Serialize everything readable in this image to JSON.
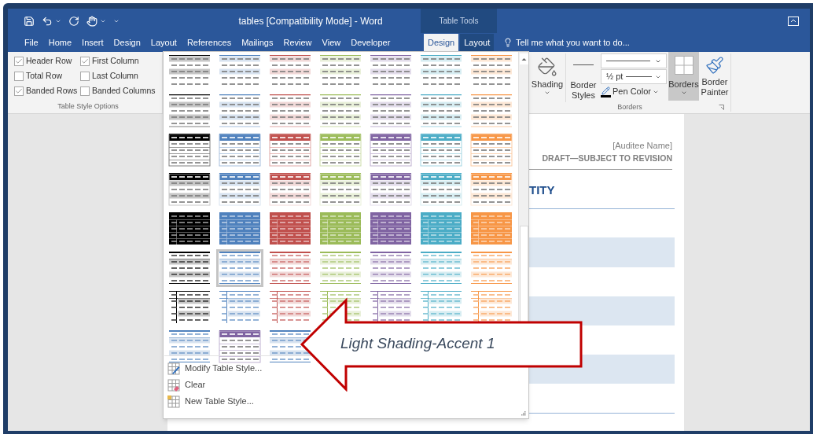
{
  "window": {
    "title": "tables [Compatibility Mode] - Word",
    "contextual_group": "Table Tools"
  },
  "tabs": [
    {
      "label": "File",
      "selected": false,
      "contextual": false
    },
    {
      "label": "Home",
      "selected": false,
      "contextual": false
    },
    {
      "label": "Insert",
      "selected": false,
      "contextual": false
    },
    {
      "label": "Design",
      "selected": false,
      "contextual": false
    },
    {
      "label": "Layout",
      "selected": false,
      "contextual": false
    },
    {
      "label": "References",
      "selected": false,
      "contextual": false
    },
    {
      "label": "Mailings",
      "selected": false,
      "contextual": false
    },
    {
      "label": "Review",
      "selected": false,
      "contextual": false
    },
    {
      "label": "View",
      "selected": false,
      "contextual": false
    },
    {
      "label": "Developer",
      "selected": false,
      "contextual": false
    },
    {
      "label": "Design",
      "selected": true,
      "contextual": true
    },
    {
      "label": "Layout",
      "selected": false,
      "contextual": true
    }
  ],
  "tell_me": {
    "placeholder": "Tell me what you want to do..."
  },
  "table_style_options": {
    "label": "Table Style Options",
    "options": [
      {
        "label": "Header Row",
        "checked": true
      },
      {
        "label": "First Column",
        "checked": true
      },
      {
        "label": "Total Row",
        "checked": false
      },
      {
        "label": "Last Column",
        "checked": false
      },
      {
        "label": "Banded Rows",
        "checked": true
      },
      {
        "label": "Banded Columns",
        "checked": false
      }
    ]
  },
  "borders_group": {
    "label": "Borders",
    "shading": "Shading",
    "border_styles": "Border Styles",
    "line_weight": "½ pt",
    "pen_color": "Pen Color",
    "borders": {
      "label": "Borders",
      "selected": true
    },
    "border_painter": "Border Painter"
  },
  "style_gallery": {
    "styles": [
      {
        "kind": "banded",
        "color": "#000000",
        "selected": false
      },
      {
        "kind": "banded",
        "color": "#4f81bd",
        "selected": false
      },
      {
        "kind": "banded",
        "color": "#c0504d",
        "selected": false
      },
      {
        "kind": "banded",
        "color": "#9bbb59",
        "selected": false
      },
      {
        "kind": "banded",
        "color": "#8064a2",
        "selected": false
      },
      {
        "kind": "banded",
        "color": "#4bacc6",
        "selected": false
      },
      {
        "kind": "banded",
        "color": "#f79646",
        "selected": false
      },
      {
        "kind": "banded-lined",
        "color": "#000000",
        "selected": false
      },
      {
        "kind": "banded-lined",
        "color": "#4f81bd",
        "selected": false
      },
      {
        "kind": "banded-lined",
        "color": "#c0504d",
        "selected": false
      },
      {
        "kind": "banded-lined",
        "color": "#9bbb59",
        "selected": false
      },
      {
        "kind": "banded-lined",
        "color": "#8064a2",
        "selected": false
      },
      {
        "kind": "banded-lined",
        "color": "#4bacc6",
        "selected": false
      },
      {
        "kind": "banded-lined",
        "color": "#f79646",
        "selected": false
      },
      {
        "kind": "grid-header",
        "color": "#000000",
        "selected": false
      },
      {
        "kind": "grid-header",
        "color": "#4f81bd",
        "selected": false
      },
      {
        "kind": "grid-header",
        "color": "#c0504d",
        "selected": false
      },
      {
        "kind": "grid-header",
        "color": "#9bbb59",
        "selected": false
      },
      {
        "kind": "grid-header",
        "color": "#8064a2",
        "selected": false
      },
      {
        "kind": "grid-header",
        "color": "#4bacc6",
        "selected": false
      },
      {
        "kind": "grid-header",
        "color": "#f79646",
        "selected": false
      },
      {
        "kind": "header-banded",
        "color": "#000000",
        "selected": false
      },
      {
        "kind": "header-banded",
        "color": "#4f81bd",
        "selected": false
      },
      {
        "kind": "header-banded",
        "color": "#c0504d",
        "selected": false
      },
      {
        "kind": "header-banded",
        "color": "#9bbb59",
        "selected": false
      },
      {
        "kind": "header-banded",
        "color": "#8064a2",
        "selected": false
      },
      {
        "kind": "header-banded",
        "color": "#4bacc6",
        "selected": false
      },
      {
        "kind": "header-banded",
        "color": "#f79646",
        "selected": false
      },
      {
        "kind": "solid",
        "color": "#000000",
        "selected": false
      },
      {
        "kind": "solid",
        "color": "#4f81bd",
        "selected": false
      },
      {
        "kind": "solid",
        "color": "#c0504d",
        "selected": false
      },
      {
        "kind": "solid",
        "color": "#9bbb59",
        "selected": false
      },
      {
        "kind": "solid",
        "color": "#8064a2",
        "selected": false
      },
      {
        "kind": "solid",
        "color": "#4bacc6",
        "selected": false
      },
      {
        "kind": "solid",
        "color": "#f79646",
        "selected": false
      },
      {
        "kind": "lined-banded",
        "color": "#000000",
        "selected": false
      },
      {
        "kind": "lined-banded",
        "color": "#4f81bd",
        "selected": true
      },
      {
        "kind": "lined-banded",
        "color": "#c0504d",
        "selected": false
      },
      {
        "kind": "lined-banded",
        "color": "#9bbb59",
        "selected": false
      },
      {
        "kind": "lined-banded",
        "color": "#8064a2",
        "selected": false
      },
      {
        "kind": "lined-banded",
        "color": "#4bacc6",
        "selected": false
      },
      {
        "kind": "lined-banded",
        "color": "#f79646",
        "selected": false
      },
      {
        "kind": "first-column",
        "color": "#000000",
        "selected": false
      },
      {
        "kind": "first-column",
        "color": "#4f81bd",
        "selected": false
      },
      {
        "kind": "first-column",
        "color": "#c0504d",
        "selected": false
      },
      {
        "kind": "first-column",
        "color": "#9bbb59",
        "selected": false
      },
      {
        "kind": "first-column",
        "color": "#8064a2",
        "selected": false
      },
      {
        "kind": "first-column",
        "color": "#4bacc6",
        "selected": false
      },
      {
        "kind": "first-column",
        "color": "#f79646",
        "selected": false
      },
      {
        "kind": "lined-banded",
        "color": "#4f81bd",
        "selected": false
      },
      {
        "kind": "grid-header",
        "color": "#8064a2",
        "selected": false
      },
      {
        "kind": "lined-banded",
        "color": "#4f81bd",
        "selected": false
      }
    ],
    "menu": [
      {
        "label": "Modify Table Style...",
        "kind": "modify"
      },
      {
        "label": "Clear",
        "kind": "clear"
      },
      {
        "label": "New Table Style...",
        "kind": "new"
      }
    ]
  },
  "document": {
    "header_name": "[Auditee Name]",
    "header_status": "DRAFT—SUBJECT TO REVISION",
    "heading": "TITY"
  },
  "callout": {
    "text": "Light Shading-Accent 1"
  }
}
